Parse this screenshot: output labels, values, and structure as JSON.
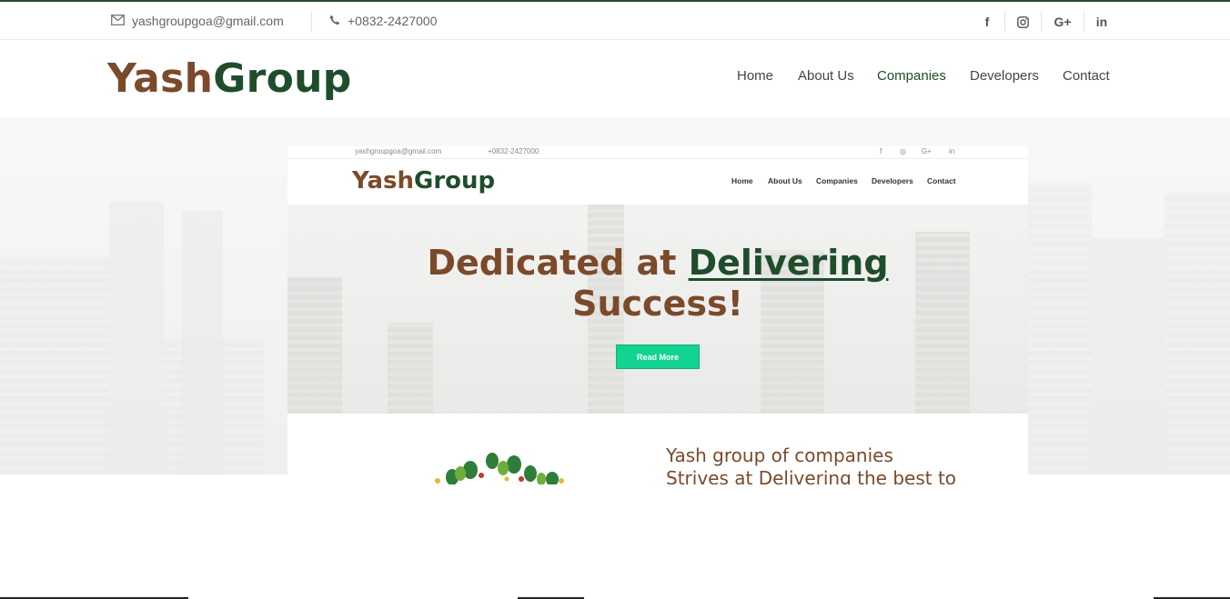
{
  "topbar": {
    "email": "yashgroupgoa@gmail.com",
    "phone": "+0832-2427000",
    "email_icon": "envelope-icon",
    "phone_icon": "phone-icon",
    "social": [
      {
        "label": "f",
        "icon": "facebook-icon"
      },
      {
        "label": "◎",
        "icon": "instagram-icon"
      },
      {
        "label": "G+",
        "icon": "google-plus-icon"
      },
      {
        "label": "in",
        "icon": "linkedin-icon"
      }
    ]
  },
  "header": {
    "logo_part1": "Yash",
    "logo_part2": "Group",
    "nav": [
      "Home",
      "About Us",
      "Companies",
      "Developers",
      "Contact"
    ],
    "active_nav": "Companies"
  },
  "preview": {
    "topbar_email": "yashgroupgoa@gmail.com",
    "topbar_phone": "+0832-2427000",
    "logo_part1": "Yash",
    "logo_part2": "Group",
    "nav": [
      "Home",
      "About Us",
      "Companies",
      "Developers",
      "Contact"
    ],
    "headline_part1": "Dedicated at ",
    "headline_highlight": "Delivering",
    "headline_line2": "Success!",
    "button_label": "Read More",
    "body_line1": "Yash group of companies",
    "body_line2": "Strives at Delivering the best to"
  },
  "colors": {
    "brown": "#7b4a2a",
    "green": "#1f4d2c",
    "button": "#12d38f"
  }
}
